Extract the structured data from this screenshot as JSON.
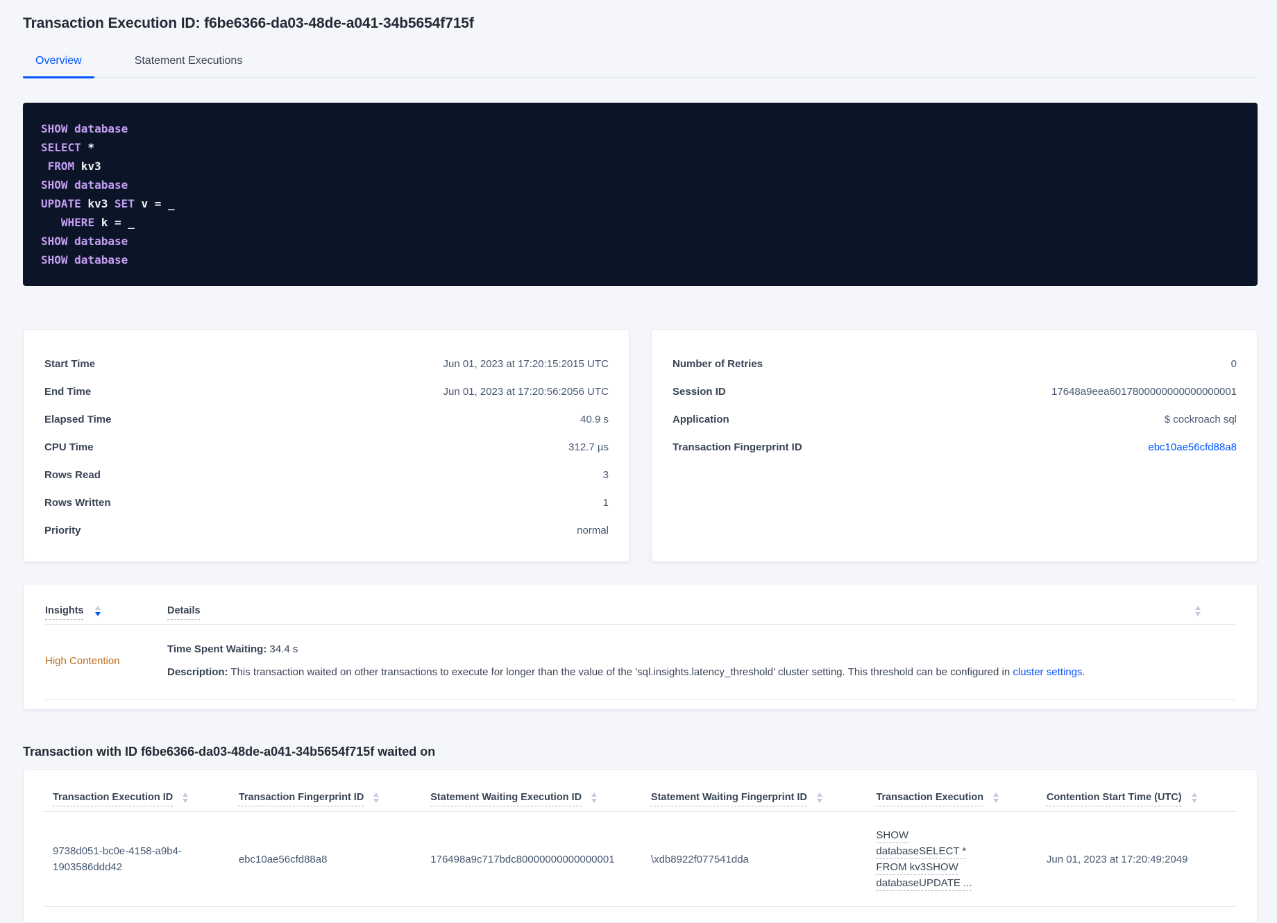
{
  "page": {
    "title": "Transaction Execution ID: f6be6366-da03-48de-a041-34b5654f715f",
    "waited_on_title": "Transaction with ID f6be6366-da03-48de-a041-34b5654f715f waited on"
  },
  "tabs": [
    {
      "label": "Overview",
      "active": true
    },
    {
      "label": "Statement Executions",
      "active": false
    }
  ],
  "sql_block": {
    "lines": [
      [
        {
          "t": "SHOW database",
          "k": 1
        }
      ],
      [
        {
          "t": "SELECT",
          "k": 1
        },
        {
          "t": " *",
          "k": 0
        }
      ],
      [
        {
          "t": " ",
          "k": 0
        },
        {
          "t": "FROM",
          "k": 1
        },
        {
          "t": " kv3",
          "k": 0
        }
      ],
      [
        {
          "t": "SHOW database",
          "k": 1
        }
      ],
      [
        {
          "t": "UPDATE",
          "k": 1
        },
        {
          "t": " kv3 ",
          "k": 0
        },
        {
          "t": "SET",
          "k": 1
        },
        {
          "t": " v = _",
          "k": 0
        }
      ],
      [
        {
          "t": "   ",
          "k": 0
        },
        {
          "t": "WHERE",
          "k": 1
        },
        {
          "t": " k = _",
          "k": 0
        }
      ],
      [
        {
          "t": "SHOW database",
          "k": 1
        }
      ],
      [
        {
          "t": "SHOW database",
          "k": 1
        }
      ]
    ]
  },
  "summary_left": {
    "rows": [
      {
        "label": "Start Time",
        "value": "Jun 01, 2023 at 17:20:15:2015 UTC"
      },
      {
        "label": "End Time",
        "value": "Jun 01, 2023 at 17:20:56:2056 UTC"
      },
      {
        "label": "Elapsed Time",
        "value": "40.9 s"
      },
      {
        "label": "CPU Time",
        "value": "312.7 µs"
      },
      {
        "label": "Rows Read",
        "value": "3"
      },
      {
        "label": "Rows Written",
        "value": "1"
      },
      {
        "label": "Priority",
        "value": "normal"
      }
    ]
  },
  "summary_right": {
    "rows": [
      {
        "label": "Number of Retries",
        "value": "0"
      },
      {
        "label": "Session ID",
        "value": "17648a9eea6017800000000000000001"
      },
      {
        "label": "Application",
        "value": "$ cockroach sql"
      },
      {
        "label": "Transaction Fingerprint ID",
        "value": "ebc10ae56cfd88a8",
        "link": true
      }
    ]
  },
  "insights": {
    "headers": {
      "insight": "Insights",
      "details": "Details"
    },
    "row": {
      "insight": "High Contention",
      "waiting_label": "Time Spent Waiting:",
      "waiting_value": "34.4 s",
      "description_label": "Description:",
      "description_text": "This transaction waited on other transactions to execute for longer than the value of the 'sql.insights.latency_threshold' cluster setting. This threshold can be configured in",
      "description_link": "cluster settings",
      "description_suffix": "."
    }
  },
  "waited_on": {
    "columns": [
      "Transaction Execution ID",
      "Transaction Fingerprint ID",
      "Statement Waiting Execution ID",
      "Statement Waiting Fingerprint ID",
      "Transaction Execution",
      "Contention Start Time (UTC)"
    ],
    "rows": [
      {
        "transaction_execution_id": "9738d051-bc0e-4158-a9b4-1903586ddd42",
        "transaction_fingerprint_id": "ebc10ae56cfd88a8",
        "statement_waiting_execution_id": "176498a9c717bdc80000000000000001",
        "statement_waiting_fingerprint_id": "\\xdb8922f077541dda",
        "transaction_execution": "SHOW databaseSELECT * FROM kv3SHOW databaseUPDATE ...",
        "contention_start_time": "Jun 01, 2023 at 17:20:49:2049"
      }
    ]
  },
  "icons": {
    "sort-icon": "stacked up/down triangles"
  },
  "colors": {
    "accent_blue": "#0055ff",
    "insight_orange": "#bd6b1d",
    "code_background": "#0c1527",
    "code_keyword": "#c39ef2",
    "code_text": "#f2f4f8",
    "page_background": "#f4f6fa"
  }
}
